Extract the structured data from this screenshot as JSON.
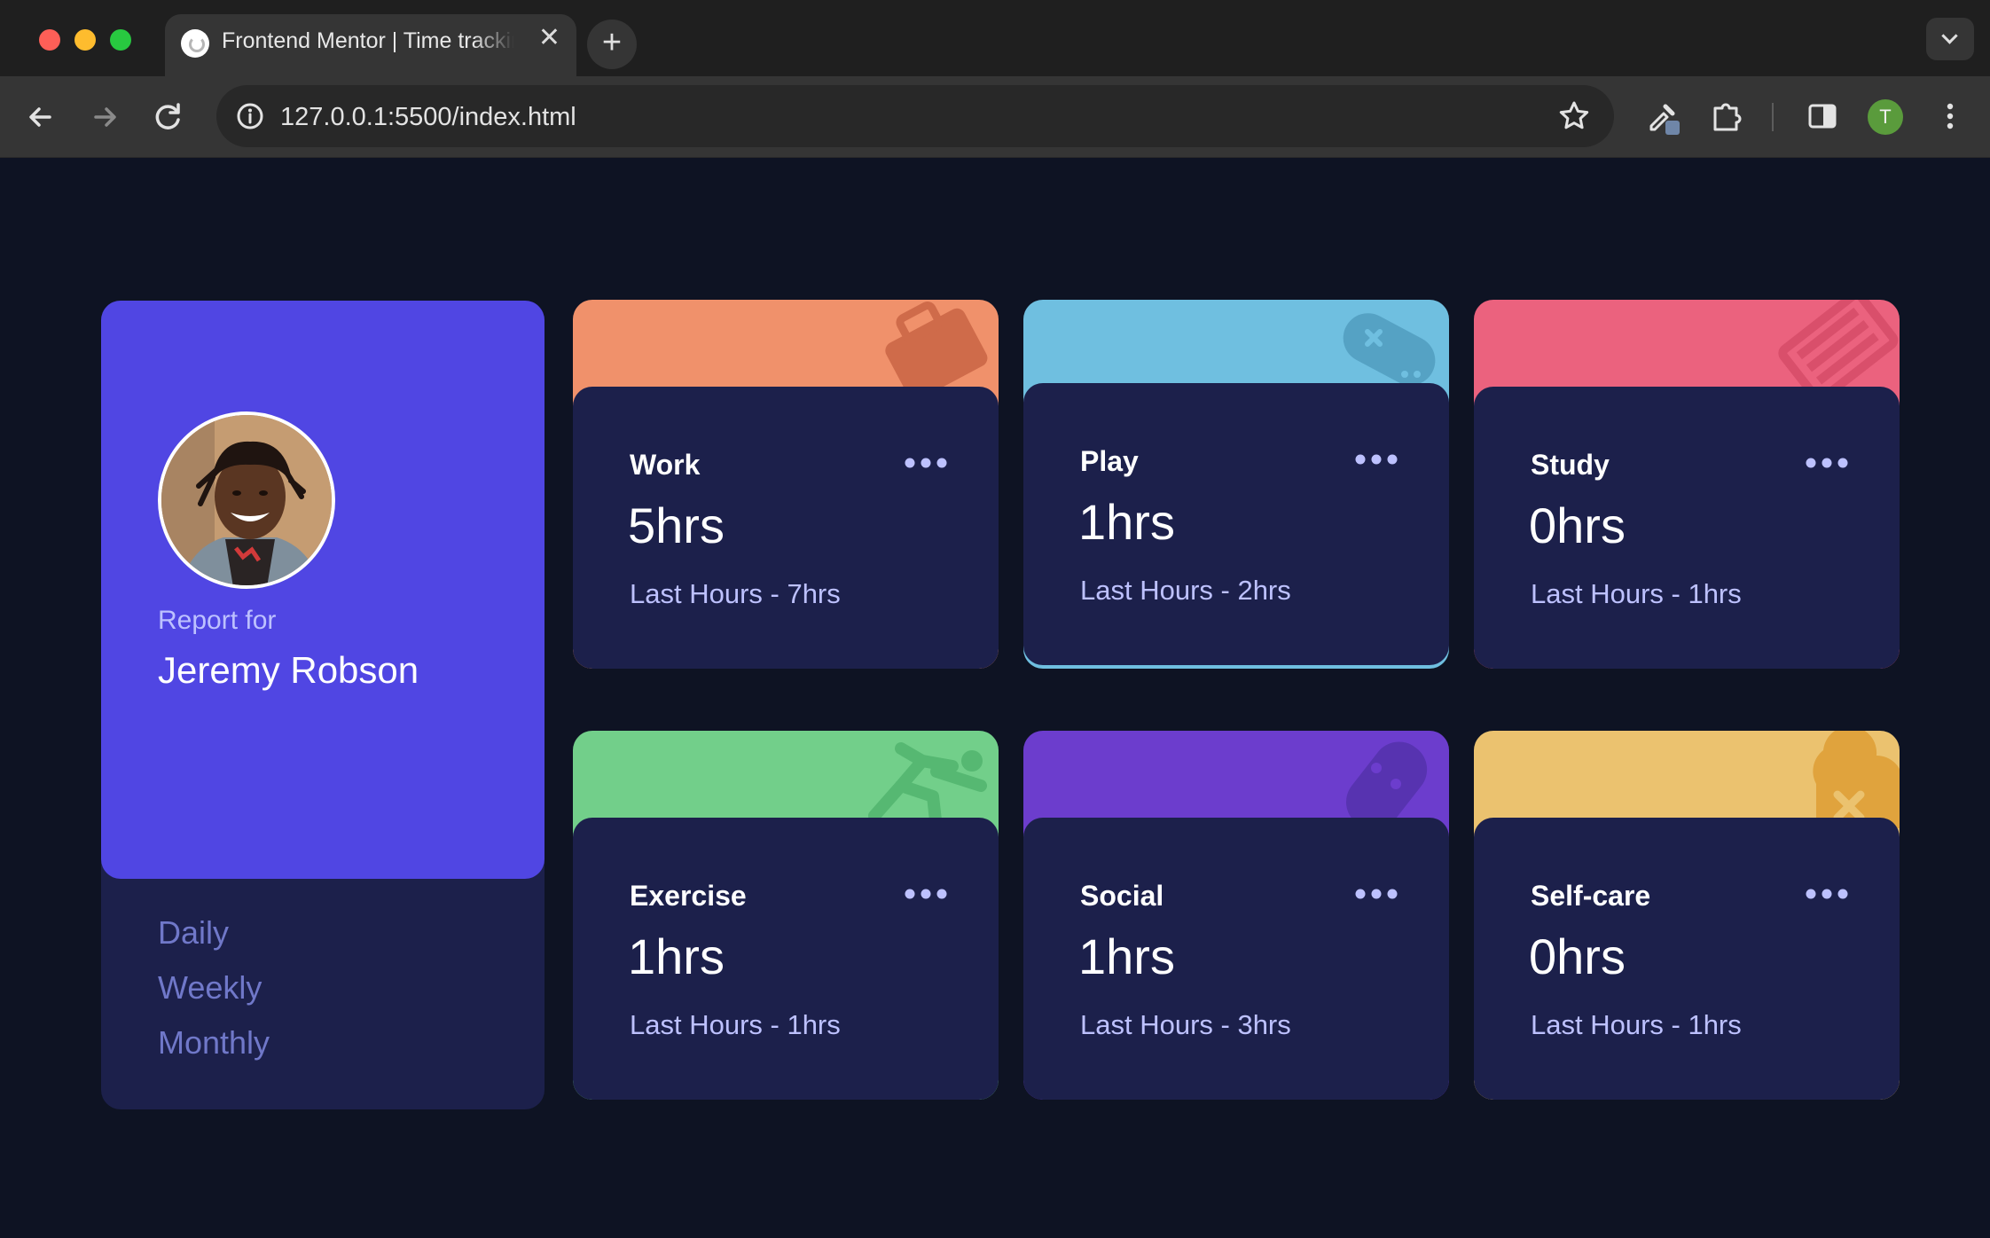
{
  "browser": {
    "tab_title": "Frontend Mentor | Time tracking dashboard",
    "tab_close": "✕",
    "new_tab": "+",
    "url": "127.0.0.1:5500/index.html",
    "profile_initial": "T"
  },
  "profile": {
    "report_label": "Report for",
    "name": "Jeremy Robson",
    "periods": [
      "Daily",
      "Weekly",
      "Monthly"
    ]
  },
  "cards": [
    {
      "title": "Work",
      "hours": "5hrs",
      "last": "Last Hours - 7hrs",
      "color": "#f0916b",
      "icon": "briefcase-icon"
    },
    {
      "title": "Play",
      "hours": "1hrs",
      "last": "Last Hours - 2hrs",
      "color": "#6fbfe0",
      "icon": "gamepad-icon"
    },
    {
      "title": "Study",
      "hours": "0hrs",
      "last": "Last Hours - 1hrs",
      "color": "#eb627e",
      "icon": "book-icon"
    },
    {
      "title": "Exercise",
      "hours": "1hrs",
      "last": "Last Hours - 1hrs",
      "color": "#72cf8a",
      "icon": "running-icon"
    },
    {
      "title": "Social",
      "hours": "1hrs",
      "last": "Last Hours - 3hrs",
      "color": "#6c3dcd",
      "icon": "social-icon"
    },
    {
      "title": "Self-care",
      "hours": "0hrs",
      "last": "Last Hours - 1hrs",
      "color": "#ebc26f",
      "icon": "heart-icon"
    }
  ],
  "colors": {
    "page_bg": "#0e1323",
    "card_bg": "#1c204b",
    "profile_bg": "#5046e3",
    "pale_blue": "#bdc1ff",
    "desaturated_blue": "#7078c9"
  }
}
